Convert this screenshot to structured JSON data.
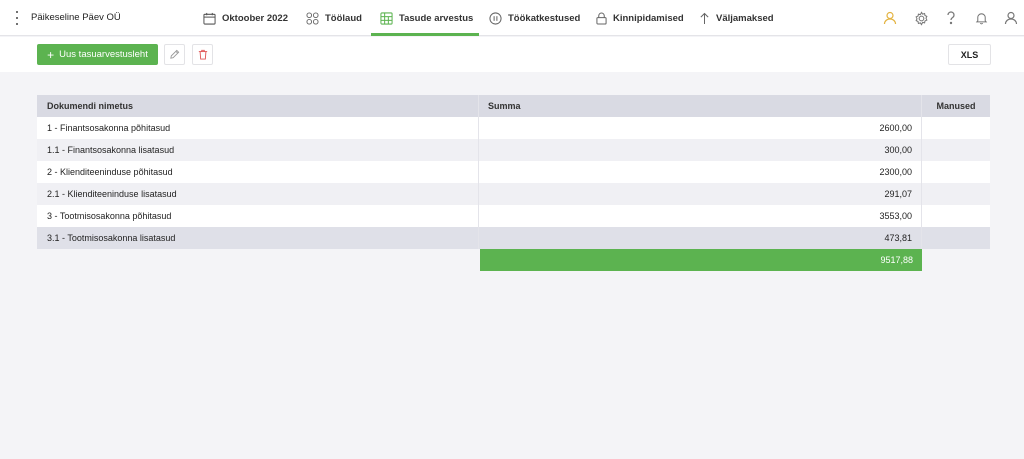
{
  "app": {
    "company": "Päikeseline Päev OÜ"
  },
  "nav": {
    "items": [
      {
        "label": "Oktoober 2022",
        "icon": "calendar-icon"
      },
      {
        "label": "Töölaud",
        "icon": "dashboard-icon"
      },
      {
        "label": "Tasude arvestus",
        "icon": "spreadsheet-icon",
        "active": true
      },
      {
        "label": "Töökatkestused",
        "icon": "pause-icon"
      },
      {
        "label": "Kinnipidamised",
        "icon": "lock-icon"
      },
      {
        "label": "Väljamaksed",
        "icon": "arrow-up-icon"
      }
    ],
    "right_icons": [
      "user-icon",
      "gear-icon",
      "help-icon",
      "bell-icon",
      "account-icon"
    ]
  },
  "toolbar": {
    "add_label": "Uus tasuarvestusleht",
    "xls_label": "XLS"
  },
  "table": {
    "columns": [
      "Dokumendi nimetus",
      "Summa",
      "Manused"
    ],
    "rows": [
      {
        "name": "1 - Finantsosakonna põhitasud",
        "sum": "2600,00",
        "attachments": ""
      },
      {
        "name": "1.1 - Finantsosakonna lisatasud",
        "sum": "300,00",
        "attachments": ""
      },
      {
        "name": "2 - Klienditeeninduse põhitasud",
        "sum": "2300,00",
        "attachments": ""
      },
      {
        "name": "2.1 - Klienditeeninduse lisatasud",
        "sum": "291,07",
        "attachments": ""
      },
      {
        "name": "3 - Tootmisosakonna põhitasud",
        "sum": "3553,00",
        "attachments": ""
      },
      {
        "name": "3.1 - Tootmisosakonna lisatasud",
        "sum": "473,81",
        "attachments": ""
      }
    ],
    "total": "9517,88"
  },
  "colors": {
    "accent": "#5cb350",
    "header_bg": "#d9dae3",
    "user_icon": "#e3b341",
    "delete_icon": "#e05555"
  }
}
